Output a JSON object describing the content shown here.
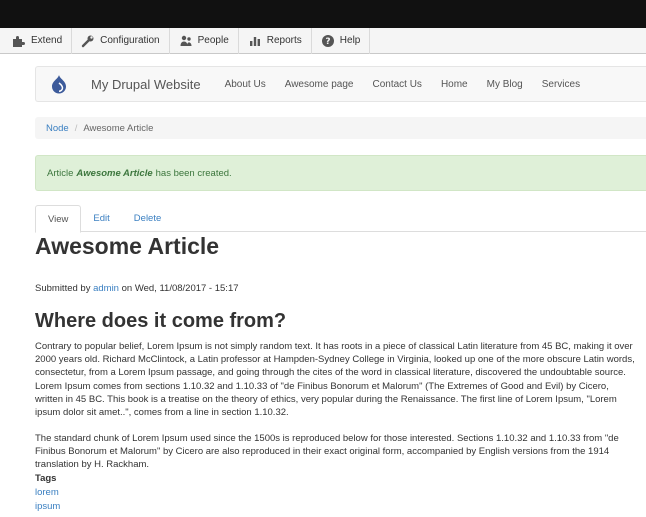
{
  "admin_toolbar": {
    "items": [
      {
        "label": "Extend",
        "icon": "puzzle-icon"
      },
      {
        "label": "Configuration",
        "icon": "wrench-icon"
      },
      {
        "label": "People",
        "icon": "people-icon"
      },
      {
        "label": "Reports",
        "icon": "bar-chart-icon"
      },
      {
        "label": "Help",
        "icon": "help-icon"
      }
    ]
  },
  "navbar": {
    "site_name": "My Drupal Website",
    "links": [
      "About Us",
      "Awesome page",
      "Contact Us",
      "Home",
      "My Blog",
      "Services"
    ]
  },
  "breadcrumb": {
    "link": "Node",
    "separator": "/",
    "current": "Awesome Article"
  },
  "alert": {
    "prefix": "Article",
    "title": "Awesome Article",
    "suffix": "has been created."
  },
  "tabs": [
    "View",
    "Edit",
    "Delete"
  ],
  "article": {
    "title": "Awesome Article",
    "submitted_prefix": "Submitted by",
    "author": "admin",
    "submitted_suffix": "on Wed, 11/08/2017 - 15:17",
    "heading": "Where does it come from?",
    "paragraph1": "Contrary to popular belief, Lorem Ipsum is not simply random text. It has roots in a piece of classical Latin literature from 45 BC, making it over 2000 years old. Richard McClintock, a Latin professor at Hampden-Sydney College in Virginia, looked up one of the more obscure Latin words, consectetur, from a Lorem Ipsum passage, and going through the cites of the word in classical literature, discovered the undoubtable source. Lorem Ipsum comes from sections 1.10.32 and 1.10.33 of \"de Finibus Bonorum et Malorum\" (The Extremes of Good and Evil) by Cicero, written in 45 BC. This book is a treatise on the theory of ethics, very popular during the Renaissance. The first line of Lorem Ipsum, \"Lorem ipsum dolor sit amet..\", comes from a line in section 1.10.32.",
    "paragraph2": "The standard chunk of Lorem Ipsum used since the 1500s is reproduced below for those interested. Sections 1.10.32 and 1.10.33 from \"de Finibus Bonorum et Malorum\" by Cicero are also reproduced in their exact original form, accompanied by English versions from the 1914 translation by H. Rackham.",
    "tags_label": "Tags",
    "tags": [
      "lorem",
      "ipsum"
    ]
  },
  "colors": {
    "link": "#3a7fc1",
    "alert_bg": "#dff0d8",
    "alert_text": "#3c763d",
    "drupal_blue": "#3d5b9b"
  }
}
